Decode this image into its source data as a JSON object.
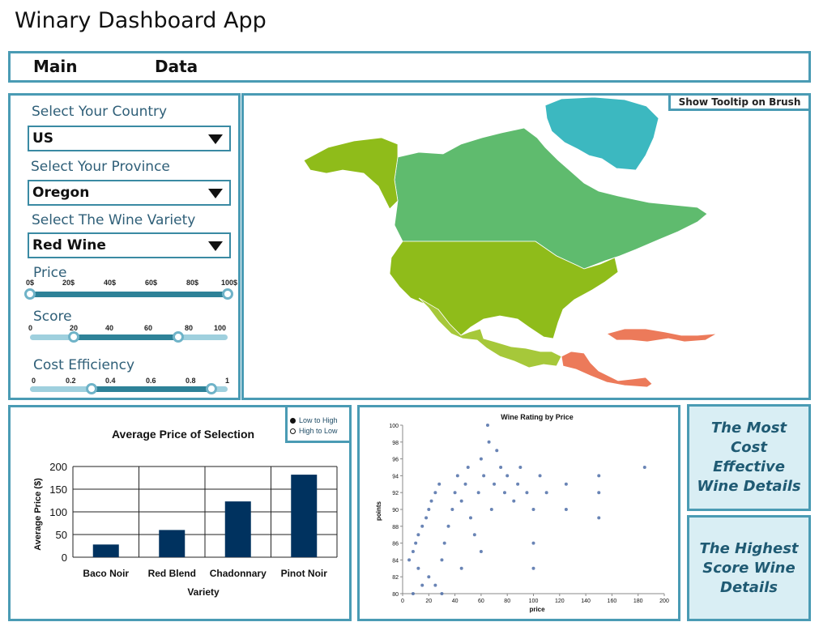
{
  "app": {
    "title": "Winary Dashboard App"
  },
  "nav": {
    "main": "Main",
    "data": "Data"
  },
  "filters": {
    "country_label": "Select Your Country",
    "country_value": "US",
    "province_label": "Select Your Province",
    "province_value": "Oregon",
    "variety_label": "Select The Wine Variety",
    "variety_value": "Red Wine"
  },
  "sliders": {
    "price": {
      "label": "Price",
      "ticks": [
        "0$",
        "20$",
        "40$",
        "60$",
        "80$",
        "100$"
      ],
      "min": 0,
      "max": 100,
      "low": 0,
      "high": 100
    },
    "score": {
      "label": "Score",
      "ticks": [
        "0",
        "20",
        "40",
        "60",
        "80",
        "100"
      ],
      "min": 0,
      "max": 100,
      "low": 22,
      "high": 75
    },
    "cost": {
      "label": "Cost Efficiency",
      "ticks": [
        "0",
        "0.2",
        "0.4",
        "0.6",
        "0.8",
        "1"
      ],
      "min": 0,
      "max": 1,
      "low": 0.31,
      "high": 0.92
    }
  },
  "map": {
    "tooltip_button": "Show Tooltip on Brush",
    "colors": {
      "alaska": "#8fbc1a",
      "canada": "#5fbb6e",
      "greenland": "#3cb8c0",
      "usa": "#8fbc1a",
      "mexico": "#a6c83a",
      "central": "#ec7a5a",
      "caribbean": "#ec7a5a"
    }
  },
  "sort": {
    "low_to_high": "Low to High",
    "high_to_low": "High to Low",
    "selected": "low_to_high"
  },
  "bar_chart": {
    "chart_data": {
      "type": "bar",
      "title": "Average Price of Selection",
      "categories": [
        "Baco Noir",
        "Red Blend",
        "Chadonnary",
        "Pinot Noir"
      ],
      "values": [
        28,
        60,
        123,
        182
      ],
      "xlabel": "Variety",
      "ylabel": "Average Price ($)",
      "ylim": [
        0,
        200
      ],
      "yticks": [
        0,
        50,
        100,
        150,
        200
      ],
      "ytick_labels": [
        "0",
        "50",
        "100",
        "150",
        "200"
      ],
      "bar_color": "#00325f",
      "grid": true
    }
  },
  "scatter_chart": {
    "chart_data": {
      "type": "scatter",
      "title": "Wine Rating by Price",
      "xlabel": "price",
      "ylabel": "points",
      "xlim": [
        0,
        200
      ],
      "ylim": [
        80,
        100
      ],
      "xticks": [
        0,
        20,
        40,
        60,
        80,
        100,
        120,
        140,
        160,
        180,
        200
      ],
      "yticks": [
        80,
        82,
        84,
        86,
        88,
        90,
        92,
        94,
        96,
        98,
        100
      ],
      "point_color": "#4f6fa8",
      "points": [
        [
          5,
          84
        ],
        [
          8,
          85
        ],
        [
          10,
          86
        ],
        [
          12,
          87
        ],
        [
          15,
          88
        ],
        [
          18,
          89
        ],
        [
          20,
          90
        ],
        [
          22,
          91
        ],
        [
          25,
          92
        ],
        [
          28,
          93
        ],
        [
          30,
          84
        ],
        [
          32,
          86
        ],
        [
          35,
          88
        ],
        [
          38,
          90
        ],
        [
          40,
          92
        ],
        [
          42,
          94
        ],
        [
          45,
          91
        ],
        [
          48,
          93
        ],
        [
          50,
          95
        ],
        [
          52,
          89
        ],
        [
          55,
          87
        ],
        [
          58,
          92
        ],
        [
          60,
          96
        ],
        [
          62,
          94
        ],
        [
          65,
          100
        ],
        [
          66,
          98
        ],
        [
          68,
          90
        ],
        [
          70,
          93
        ],
        [
          72,
          97
        ],
        [
          75,
          95
        ],
        [
          78,
          92
        ],
        [
          80,
          94
        ],
        [
          85,
          91
        ],
        [
          88,
          93
        ],
        [
          90,
          95
        ],
        [
          95,
          92
        ],
        [
          100,
          90
        ],
        [
          100,
          86
        ],
        [
          105,
          94
        ],
        [
          110,
          92
        ],
        [
          125,
          93
        ],
        [
          125,
          90
        ],
        [
          150,
          94
        ],
        [
          150,
          92
        ],
        [
          150,
          89
        ],
        [
          185,
          95
        ],
        [
          12,
          83
        ],
        [
          20,
          82
        ],
        [
          25,
          81
        ],
        [
          30,
          80
        ],
        [
          45,
          83
        ],
        [
          60,
          85
        ],
        [
          100,
          83
        ],
        [
          8,
          80
        ],
        [
          15,
          81
        ]
      ]
    }
  },
  "info": {
    "cost_effective": "The Most Cost Effective Wine Details",
    "highest_score": "The Highest Score Wine Details"
  }
}
